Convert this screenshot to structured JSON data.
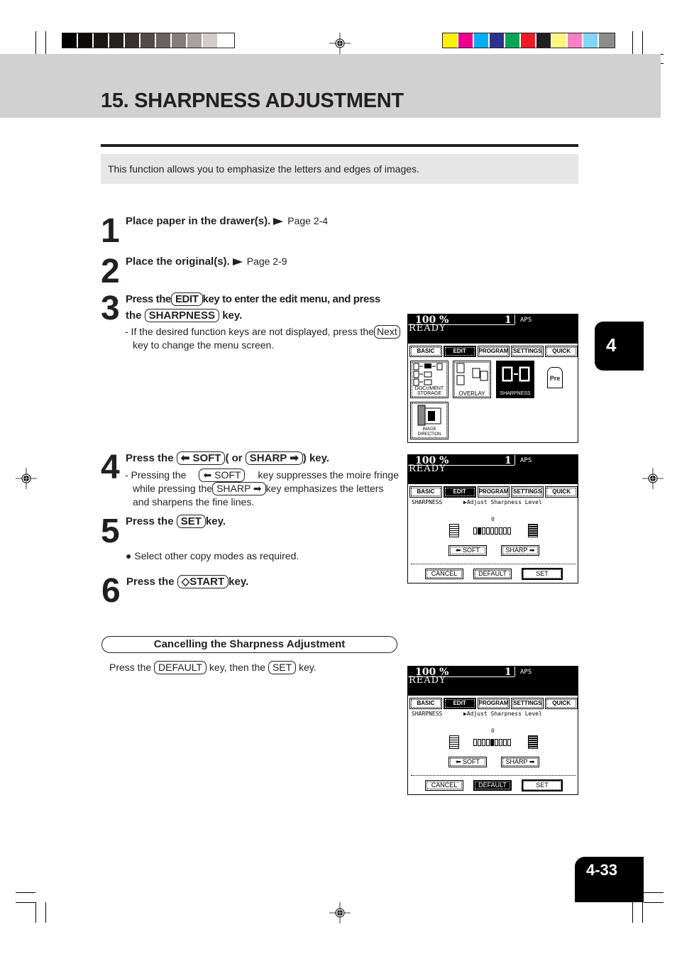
{
  "print_marks": {
    "grayscale_swatches": [
      "#000000",
      "#0d0b0a",
      "#1a1716",
      "#262220",
      "#3a302d",
      "#544a47",
      "#6c615e",
      "#867c79",
      "#a7a09e",
      "#d3cbca",
      "#ffffff"
    ],
    "color_swatches": [
      "#fff200",
      "#ec008c",
      "#00aeef",
      "#2e3192",
      "#00a651",
      "#ed1c24",
      "#231f20",
      "#fff57f",
      "#f580c4",
      "#7fd6f7",
      "#8c8c8c"
    ]
  },
  "header": {
    "title": "15. SHARPNESS ADJUSTMENT",
    "intro": "This function allows you to emphasize the letters and edges of images."
  },
  "steps": [
    {
      "number": "1",
      "text": "Place paper in the drawer(s).",
      "ref": "Page 2-4"
    },
    {
      "number": "2",
      "text": "Place the original(s).",
      "ref": "Page 2-9"
    },
    {
      "number": "3",
      "text_a": "Press the",
      "key_a": "EDIT",
      "text_b": "key to enter the edit menu, and  press",
      "text_c": "the",
      "key_b": "SHARPNESS",
      "text_d": "key.",
      "note_a": "- If the desired function keys are not displayed, press the",
      "note_key": "Next",
      "note_b": "key to change the menu screen."
    },
    {
      "number": "4",
      "text_a": "Press the",
      "key_a": "⬅ SOFT",
      "text_b": "( or",
      "key_b": "SHARP ➡",
      "text_c": ") key.",
      "note_a": "- Pressing the",
      "note_key_a": "⬅ SOFT",
      "note_b": "key suppresses the moire fringe",
      "note_c": "while pressing the",
      "note_key_b": "SHARP ➡",
      "note_d": "key emphasizes the letters",
      "note_e": "and sharpens the fine lines."
    },
    {
      "number": "5",
      "text_a": "Press the",
      "key": "SET",
      "text_b": "key.",
      "bullet": "Select other copy modes as required."
    },
    {
      "number": "6",
      "text_a": "Press the",
      "key": "◇START",
      "text_b": "key."
    }
  ],
  "cancel_section": {
    "title": "Cancelling the Sharpness Adjustment",
    "text_a": "Press the",
    "key_a": "DEFAULT",
    "text_b": "key, then the",
    "key_b": "SET",
    "text_c": "key."
  },
  "side_tab": "4",
  "page_number": "4-33",
  "lcd": {
    "zoom": "100  %",
    "count": "1",
    "paper": "APS",
    "status": "READY",
    "tabs": [
      "BASIC",
      "EDIT",
      "PROGRAM",
      "SETTINGS",
      "QUICK"
    ],
    "active_tab": "EDIT",
    "edit_menu": {
      "keys": [
        "DOCUMENT STORAGE",
        "OVERLAY",
        "SHARPNESS",
        "IMAGE DIRECTION"
      ],
      "active_key": "SHARPNESS",
      "pre_label": "Pre"
    },
    "sharpness": {
      "label": "SHARPNESS",
      "prompt": "▶Adjust Sharpness Level",
      "zero_label": "0",
      "soft_button": "⬅ SOFT",
      "sharp_button": "SHARP ➡",
      "cancel_button": "CANCEL",
      "default_button": "DEFAULT",
      "set_button": "SET",
      "levels": 9,
      "screen2_level": 2,
      "screen3_level": 5
    }
  }
}
